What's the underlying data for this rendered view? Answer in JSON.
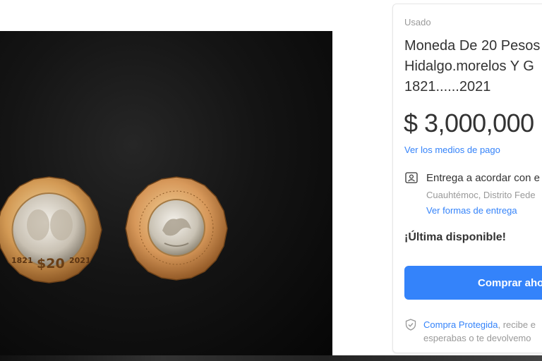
{
  "product": {
    "condition": "Usado",
    "title": "Moneda De 20 Pesos\nHidalgo.morelos Y G\n1821......2021",
    "price": "$ 3,000,000",
    "payment_link": "Ver los medios de pago"
  },
  "shipping": {
    "title": "Entrega a acordar con e",
    "location": "Cuauhtémoc, Distrito Fede",
    "link": "Ver formas de entrega"
  },
  "stock": "¡Última disponible!",
  "buy_button": "Comprar aho",
  "protection": {
    "highlight": "Compra Protegida",
    "text_1": ", recibe e",
    "text_2": "esperabas o te devolvemo"
  },
  "coins": {
    "left": {
      "year_left": "1821",
      "denomination": "$20",
      "year_right": "2021"
    }
  },
  "colors": {
    "accent": "#3483fa",
    "muted": "#999999",
    "text": "#333333",
    "photo_background": "#0a0a0a"
  },
  "icons": [
    "shipping-person-icon",
    "shield-check-icon"
  ]
}
